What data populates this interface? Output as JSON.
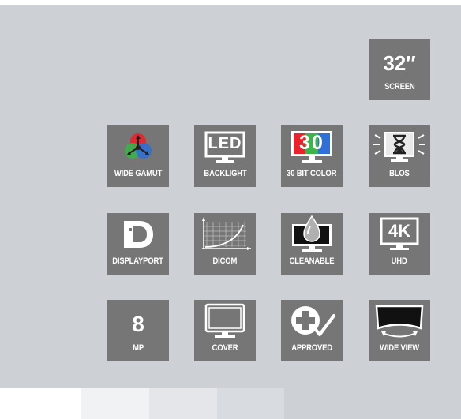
{
  "tiles": {
    "screen": {
      "value": "32″",
      "label": "SCREEN"
    },
    "wide_gamut": {
      "label": "WIDE GAMUT"
    },
    "backlight": {
      "label": "BACKLIGHT",
      "icon_text": "LED"
    },
    "color_depth": {
      "label": "30 BIT COLOR",
      "icon_text": "30"
    },
    "blos": {
      "label": "BLOS"
    },
    "displayport": {
      "label": "DISPLAYPORT"
    },
    "dicom": {
      "label": "DICOM"
    },
    "cleanable": {
      "label": "CLEANABLE"
    },
    "uhd": {
      "label": "UHD",
      "icon_text": "4K"
    },
    "megapixel": {
      "value": "8",
      "label": "MP"
    },
    "cover": {
      "label": "COVER"
    },
    "approved": {
      "label": "APPROVED"
    },
    "wide_view": {
      "label": "WIDE VIEW"
    }
  },
  "colors": {
    "panel": "#cdd1d6",
    "tile": "#767676",
    "swatches": [
      "#ffffff",
      "#f1f2f4",
      "#e4e6e9",
      "#d8dbdf",
      "#cdd1d6",
      "#c5c9ce"
    ]
  }
}
